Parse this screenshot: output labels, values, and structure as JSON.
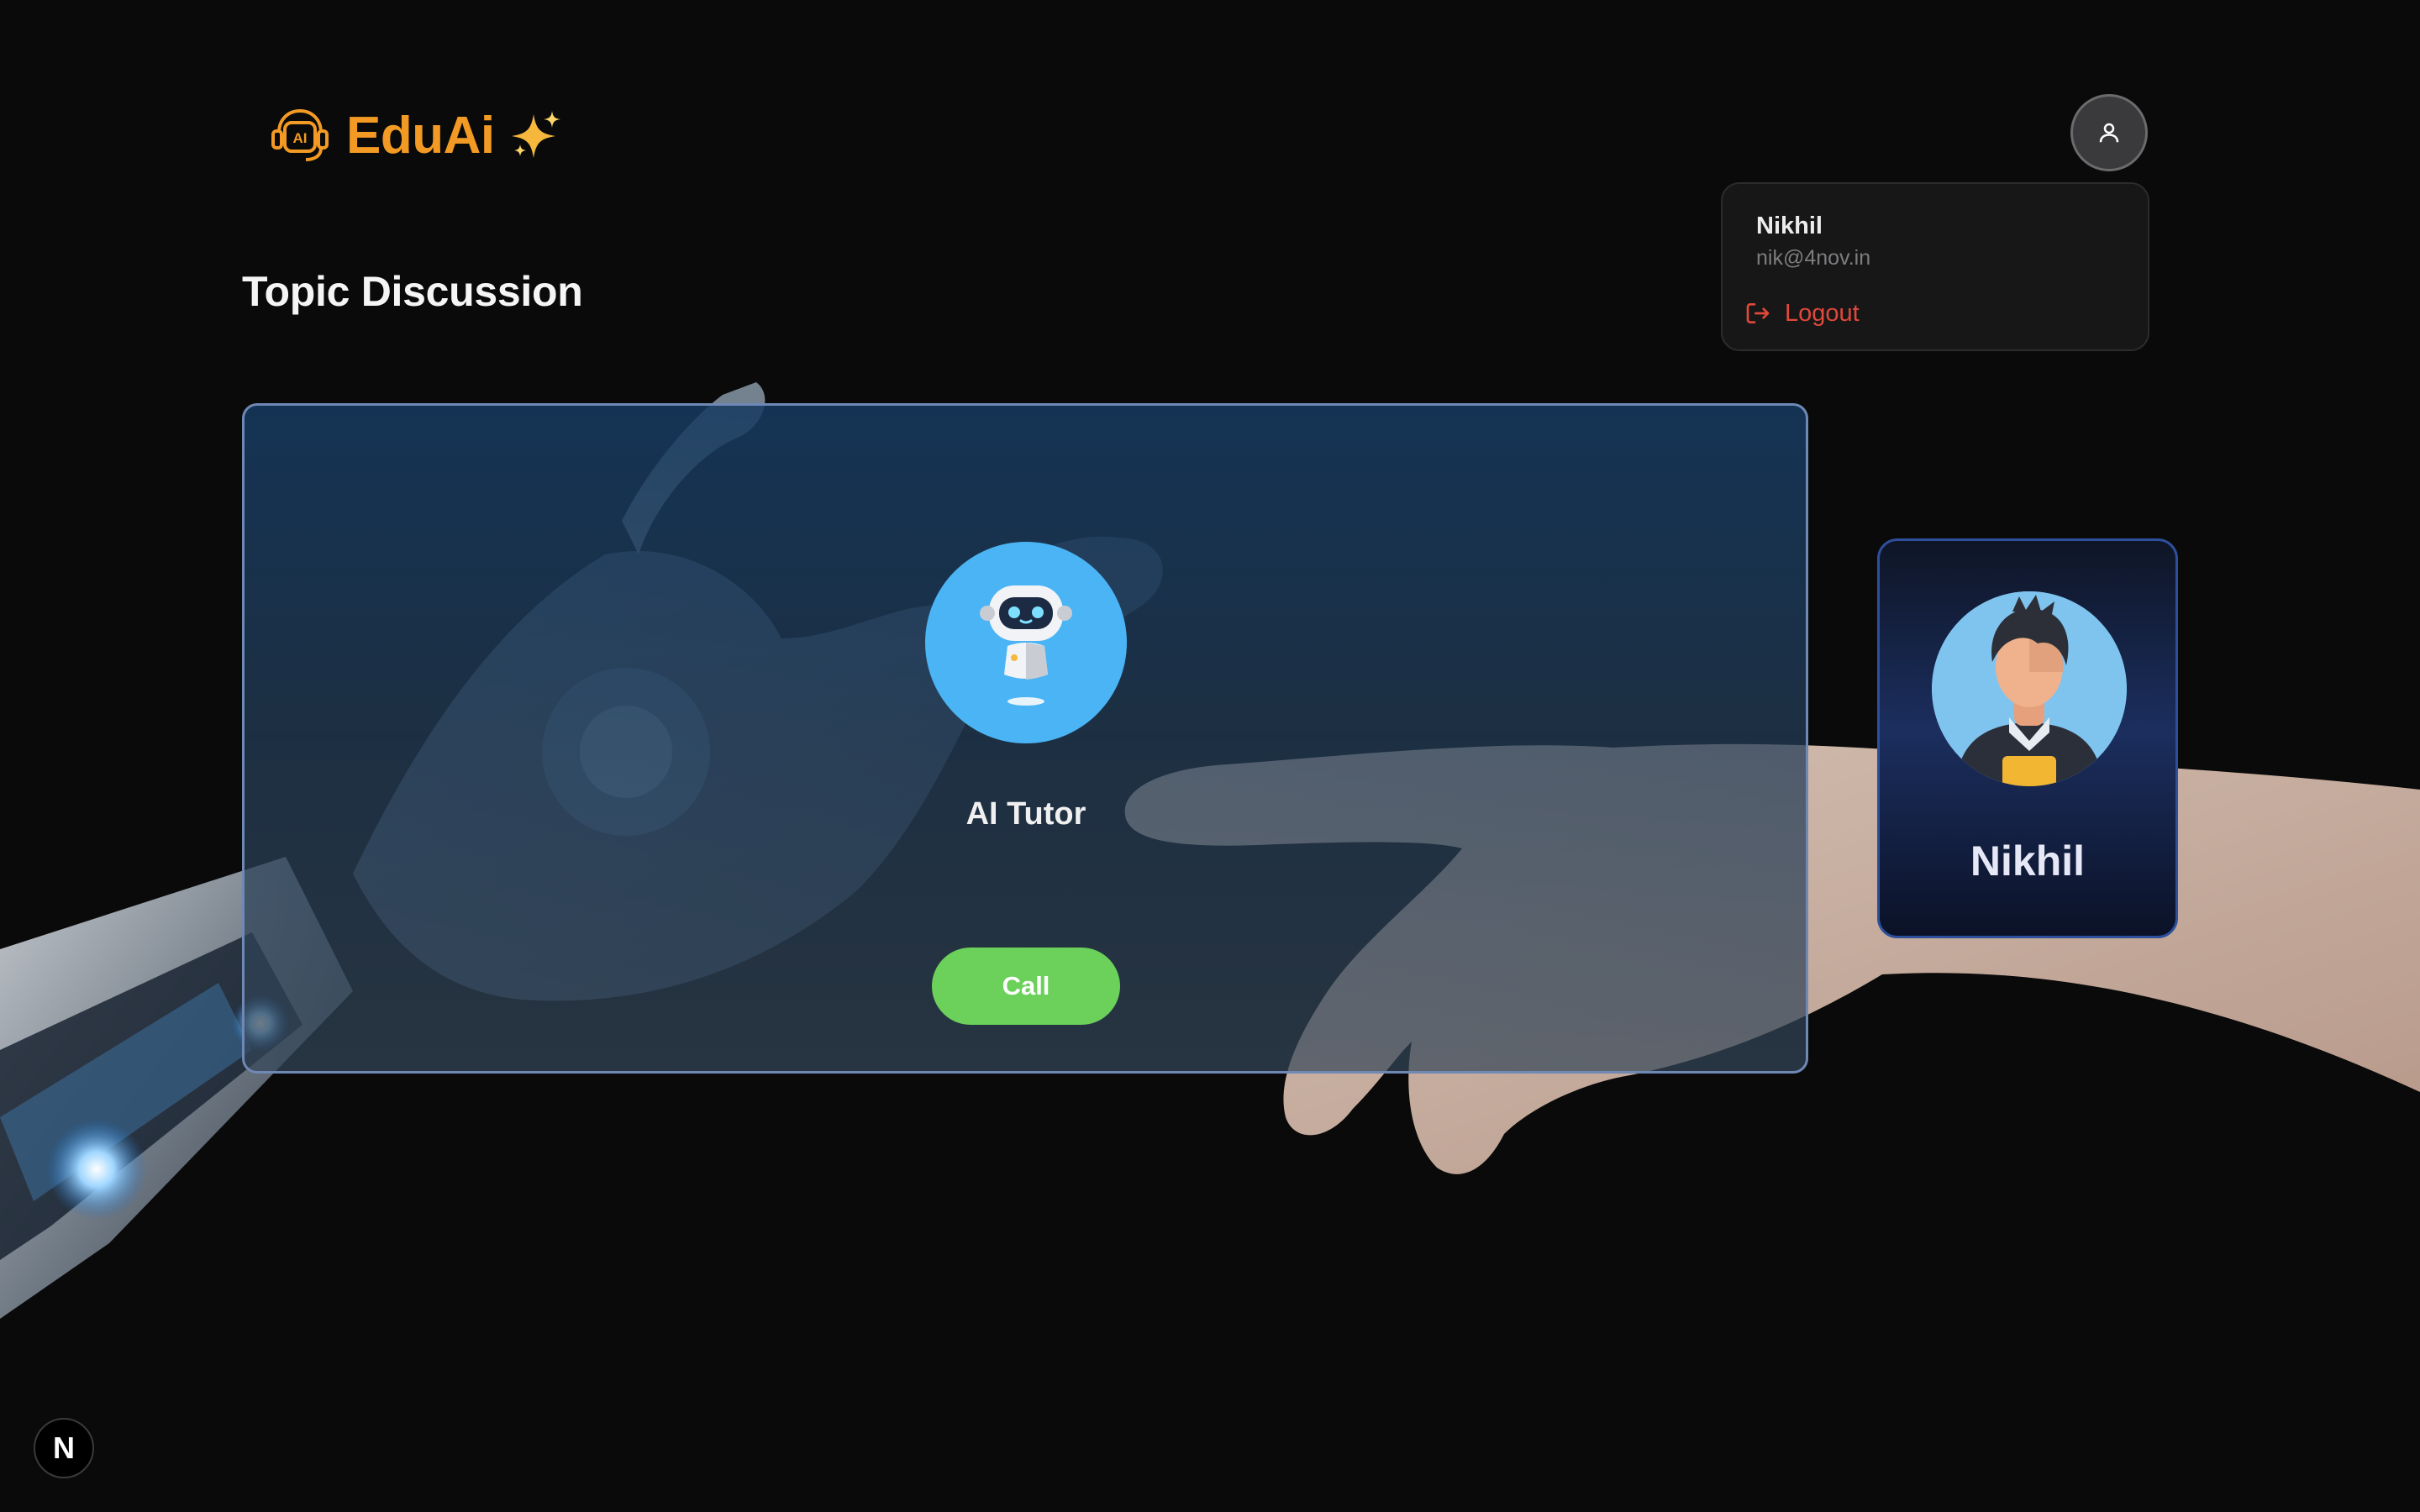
{
  "brand": {
    "name": "EduAi",
    "logo_icon": "ai-headset-icon",
    "sparkle_icon": "sparkles-icon",
    "accent_color": "#f29a24"
  },
  "page": {
    "title": "Topic Discussion"
  },
  "user_menu": {
    "button_icon": "user-icon",
    "name": "Nikhil",
    "email": "nik@4nov.in",
    "logout_label": "Logout",
    "logout_icon": "logout-icon",
    "logout_color": "#e0483b"
  },
  "call_panel": {
    "assistant_name": "AI Tutor",
    "assistant_icon": "robot-icon",
    "call_button_label": "Call",
    "call_button_color": "#6bd15a"
  },
  "user_card": {
    "name": "Nikhil",
    "avatar_icon": "person-avatar-icon"
  },
  "framework_badge": {
    "label": "N"
  }
}
